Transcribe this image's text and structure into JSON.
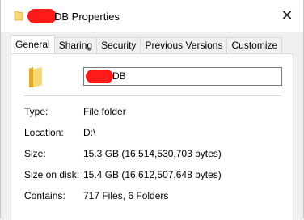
{
  "window": {
    "title_visible": "DB Properties",
    "close_glyph": "✕"
  },
  "tabs": [
    {
      "label": "General",
      "active": true
    },
    {
      "label": "Sharing",
      "active": false
    },
    {
      "label": "Security",
      "active": false
    },
    {
      "label": "Previous Versions",
      "active": false
    },
    {
      "label": "Customize",
      "active": false
    }
  ],
  "general": {
    "folder_name_visible": "DB",
    "properties": [
      {
        "label": "Type:",
        "value": "File folder"
      },
      {
        "label": "Location:",
        "value": "D:\\"
      },
      {
        "label": "Size:",
        "value": "15.3 GB (16,514,530,703 bytes)"
      },
      {
        "label": "Size on disk:",
        "value": "15.4 GB (16,612,507,648 bytes)"
      },
      {
        "label": "Contains:",
        "value": "717 Files, 6 Folders"
      }
    ]
  },
  "colors": {
    "redaction": "#ff1a1a",
    "folder_yellow": "#f8d775"
  }
}
